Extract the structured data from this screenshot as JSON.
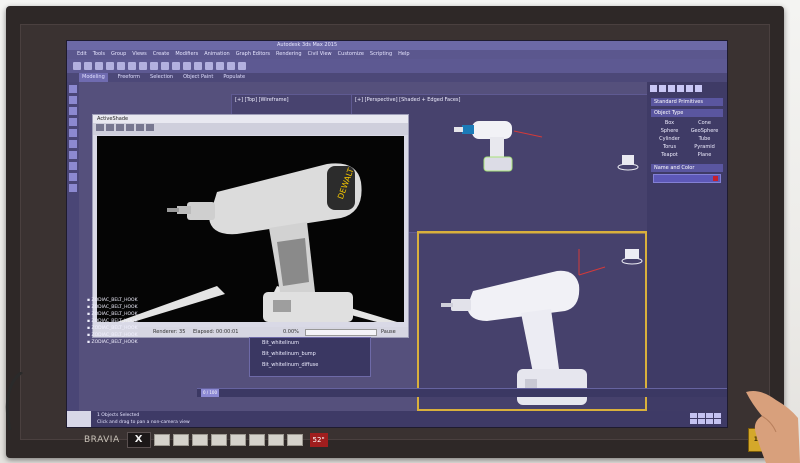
{
  "app": {
    "title": "Autodesk 3ds Max 2015",
    "menu": [
      "Edit",
      "Tools",
      "Group",
      "Views",
      "Create",
      "Modifiers",
      "Animation",
      "Graph Editors",
      "Rendering",
      "Civil View",
      "Customize",
      "Scripting",
      "Help"
    ],
    "ribbon": [
      "Modeling",
      "Freeform",
      "Selection",
      "Object Paint",
      "Populate"
    ],
    "ribbon_active": 0,
    "viewports": {
      "top": "[+] [Top] [Wireframe]",
      "perspective": "[+] [Perspective] [Shaded + Edged Faces]"
    }
  },
  "render_window": {
    "title": "ActiveShade",
    "status_left": "Renderer: 35",
    "status_mid": "Elapsed: 00:00:01",
    "status_pct": "0.00%",
    "status_right": "Pause"
  },
  "command_panel": {
    "rollout": "Standard Primitives",
    "section": "Object Type",
    "objects": [
      "Box",
      "Cone",
      "Sphere",
      "GeoSphere",
      "Cylinder",
      "Tube",
      "Torus",
      "Pyramid",
      "Teapot",
      "Plane"
    ],
    "name_section": "Name and Color"
  },
  "scene_list": [
    "ZODIAC_BELT_HOOK",
    "ZODIAC_BELT_HOOK",
    "ZODIAC_BELT_HOOK",
    "ZODIAC_BELT_HOOK",
    "ZODIAC_BELT_HOOK",
    "ZODIAC_BELT_HOOK",
    "ZODIAC_BELT_HOOK"
  ],
  "materials": [
    "Bit_whitelinum",
    "Bit_whitelinum_bump",
    "Bit_whitelinum_diffuse"
  ],
  "timeline": {
    "frame": "0 / 100"
  },
  "statusbar": {
    "line1": "1 Objects Selected",
    "line2": "Click and drag to pan a non-camera view"
  },
  "tv": {
    "brand": "BRAVIA",
    "x_badge": "X",
    "size": "52\"",
    "fourk": "100"
  },
  "colors": {
    "ui_bg": "#55507c",
    "selection_border": "#d9b03c",
    "render_bg": "#050505"
  }
}
